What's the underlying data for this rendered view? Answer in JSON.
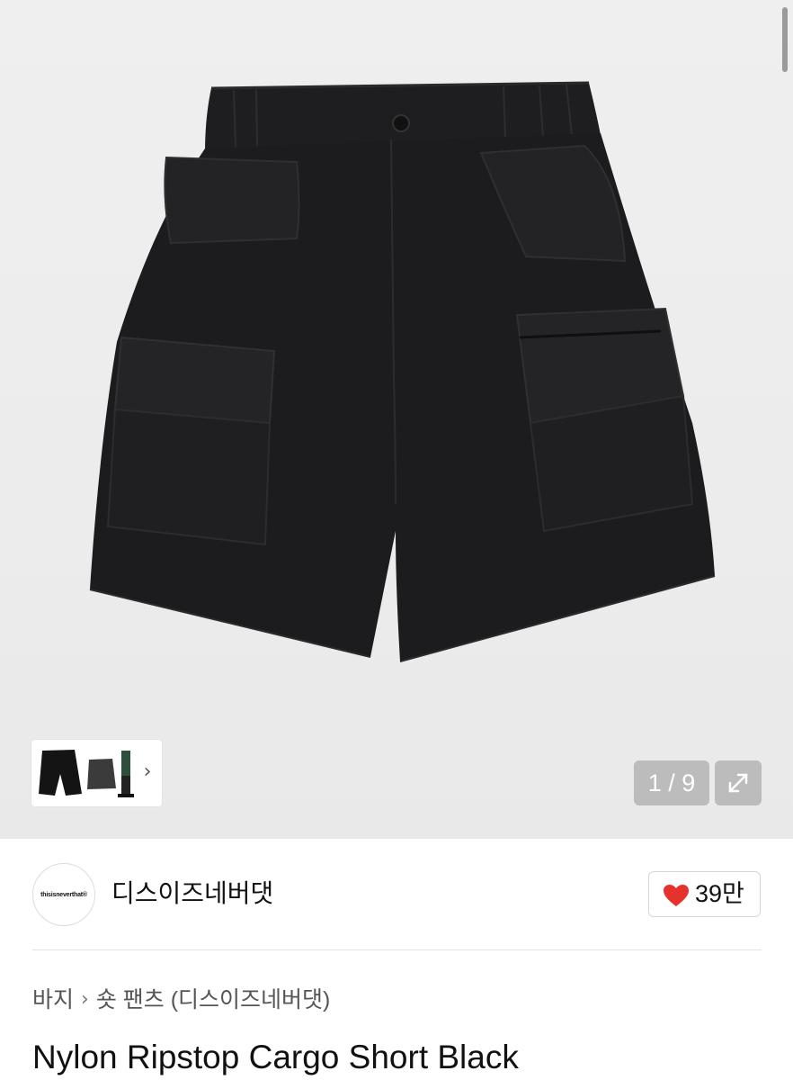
{
  "gallery": {
    "current_page": "1",
    "total_pages": "9",
    "counter_text": "1 / 9",
    "thumbnail_next_icon": "chevron-right-icon",
    "expand_icon": "expand-arrows-icon",
    "product_color": "#1c1c1e"
  },
  "brand": {
    "logo_text": "thisisneverthat®",
    "name": "디스이즈네버댓",
    "likes": "39만",
    "like_icon": "heart-icon",
    "heart_color": "#e5322d"
  },
  "breadcrumb": {
    "items": [
      "바지",
      "숏 팬츠 (디스이즈네버댓)"
    ],
    "separator_icon": "chevron-right-icon"
  },
  "product": {
    "title": "Nylon Ripstop Cargo Short Black"
  }
}
